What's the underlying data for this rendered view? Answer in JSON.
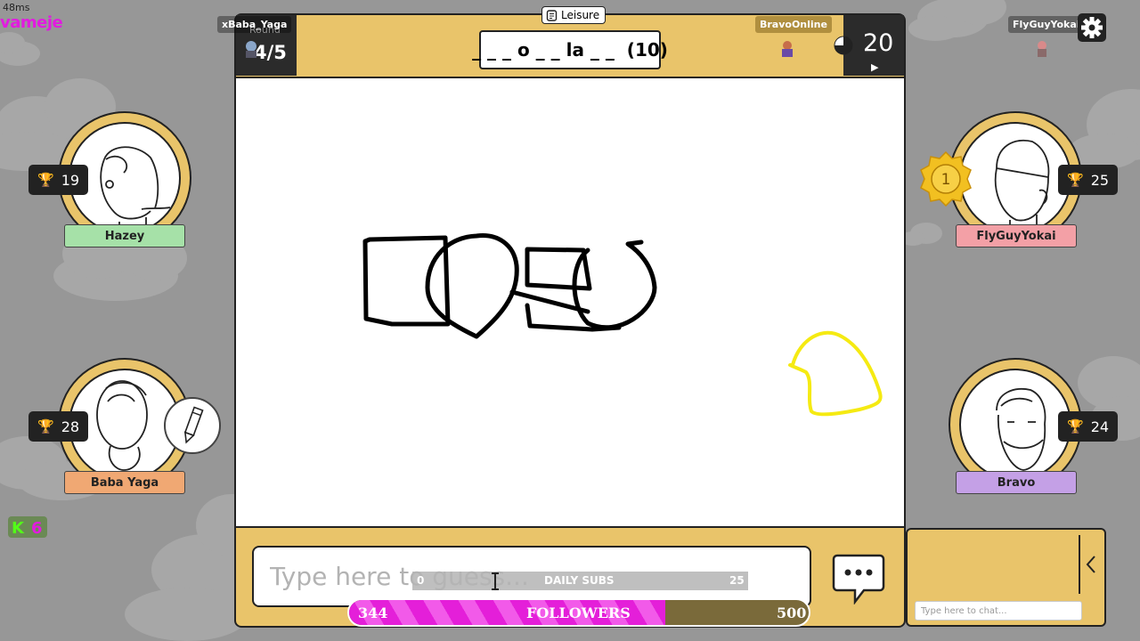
{
  "overlay": {
    "latency": "48ms",
    "streamer": "vameje",
    "viewer_left": "xBaba_Yaga",
    "viewer_right": "FlyGuyYokai",
    "drawer_tag": "BravoOnline"
  },
  "header": {
    "category": "Leisure",
    "round_label": "Round",
    "round_value": "4/5",
    "word_hint": "_ _ _ o _ _ la _ _  (10)",
    "timer": "20",
    "timer_fill": 0.75
  },
  "players": [
    {
      "name": "Hazey",
      "score": "19",
      "tag_color": "#a6e1a8",
      "drawing": false
    },
    {
      "name": "Baba Yaga",
      "score": "28",
      "tag_color": "#f0a873",
      "drawing": true
    },
    {
      "name": "FlyGuyYokai",
      "score": "25",
      "tag_color": "#f3a0a6",
      "rank": "1"
    },
    {
      "name": "Bravo",
      "score": "24",
      "tag_color": "#c4a0e6"
    }
  ],
  "guess": {
    "placeholder": "Type here to guess..."
  },
  "subs": {
    "label": "DAILY SUBS",
    "current": "0",
    "goal": "25",
    "progress": 0
  },
  "followers": {
    "label": "FOLLOWERS",
    "current": "344",
    "goal": "500",
    "progress": 0.688
  },
  "chat": {
    "placeholder": "Type here to chat..."
  },
  "colors": {
    "frame": "#e9c46a",
    "background": "#979797",
    "streamer_text": "#e21be0",
    "followers_bar": "#e41fd9"
  }
}
